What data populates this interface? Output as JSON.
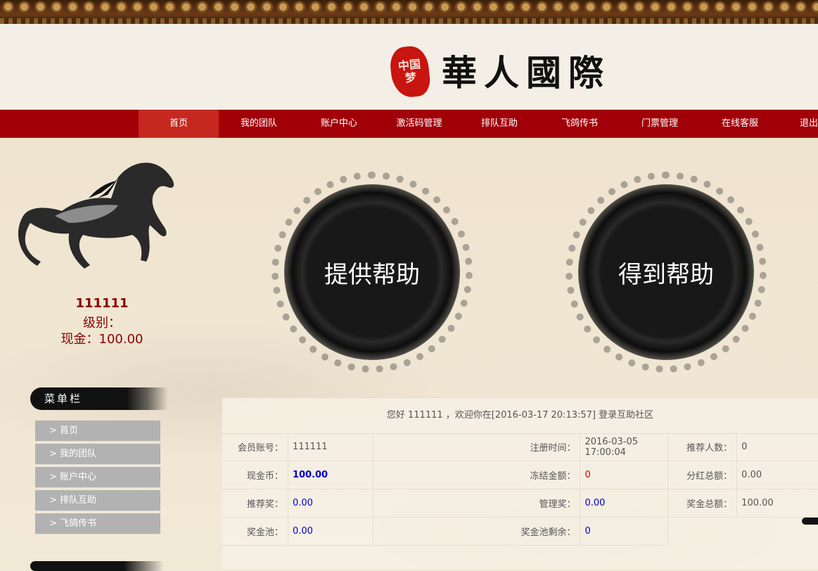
{
  "header": {
    "seal_text": "中国梦",
    "logo_text": "華人國際"
  },
  "nav": {
    "items": [
      "首页",
      "我的团队",
      "账户中心",
      "激活码管理",
      "排队互助",
      "飞鸽传书",
      "门票管理",
      "在线客服",
      "退出"
    ],
    "active_index": 0
  },
  "user": {
    "name": "111111",
    "level_label": "级别：",
    "cash_label": "现金：100.00"
  },
  "actions": {
    "provide_help": "提供帮助",
    "get_help": "得到帮助"
  },
  "menu": {
    "title": "菜单栏",
    "items": [
      "> 首页",
      "> 我的团队",
      "> 账户中心",
      "> 排队互助",
      "> 飞鸽传书"
    ]
  },
  "panel": {
    "welcome": "您好 111111 ，欢迎你在[2016-03-17 20:13:57] 登录互助社区",
    "rows": [
      [
        {
          "label": "会员账号：",
          "value": "111111"
        },
        {
          "label": "注册时间：",
          "value": "2016-03-05 17:00:04"
        },
        {
          "label": "推荐人数：",
          "value": "0"
        }
      ],
      [
        {
          "label": "现金币：",
          "value": "100.00"
        },
        {
          "label": "冻结金额：",
          "value": "0"
        },
        {
          "label": "分红总额：",
          "value": "0.00"
        }
      ],
      [
        {
          "label": "推荐奖：",
          "value": "0.00"
        },
        {
          "label": "管理奖：",
          "value": "0.00"
        },
        {
          "label": "奖金总额：",
          "value": "100.00"
        }
      ],
      [
        {
          "label": "奖金池：",
          "value": "0.00"
        },
        {
          "label": "奖金池剩余：",
          "value": "0"
        }
      ]
    ]
  },
  "colors": {
    "nav_bg": "#a10008",
    "nav_active": "#c5281f",
    "accent_red": "#8b0000",
    "value_blue": "#0000cc"
  }
}
